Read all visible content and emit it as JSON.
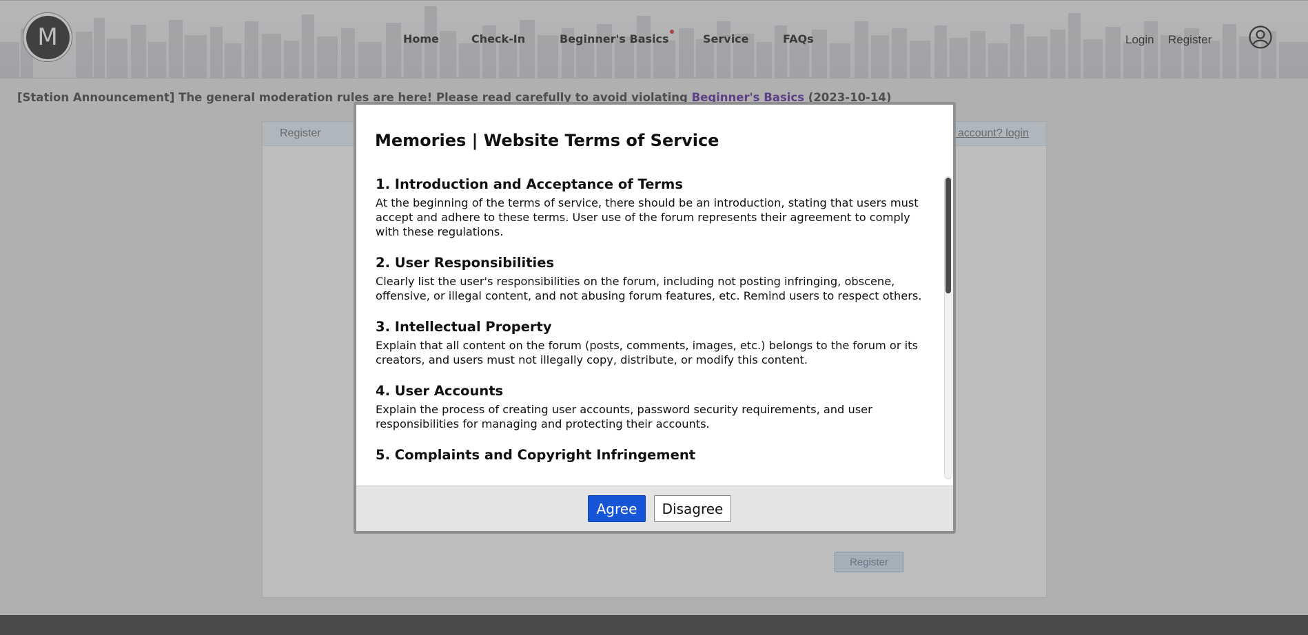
{
  "header": {
    "logo_letter": "M",
    "nav": [
      {
        "label": "Home"
      },
      {
        "label": "Check-In"
      },
      {
        "label": "Beginner's Basics"
      },
      {
        "label": "Service"
      },
      {
        "label": "FAQs"
      }
    ],
    "login_label": "Login",
    "register_label": "Register"
  },
  "announcement": {
    "text": "[Station Announcement] The general moderation rules are here! Please read carefully to avoid violating ",
    "link": "Beginner's Basics",
    "date": "(2023-10-14)"
  },
  "register_panel": {
    "tab_label": "Register",
    "login_link": "Already have an account? login",
    "submit_label": "Register"
  },
  "modal": {
    "title": "Memories | Website Terms of Service",
    "sections": [
      {
        "heading": "1. Introduction and Acceptance of Terms",
        "body": "At the beginning of the terms of service, there should be an introduction, stating that users must accept and adhere to these terms. User use of the forum represents their agreement to comply with these regulations."
      },
      {
        "heading": "2. User Responsibilities",
        "body": "Clearly list the user's responsibilities on the forum, including not posting infringing, obscene, offensive, or illegal content, and not abusing forum features, etc. Remind users to respect others."
      },
      {
        "heading": "3. Intellectual Property",
        "body": "Explain that all content on the forum (posts, comments, images, etc.) belongs to the forum or its creators, and users must not illegally copy, distribute, or modify this content."
      },
      {
        "heading": "4. User Accounts",
        "body": "Explain the process of creating user accounts, password security requirements, and user responsibilities for managing and protecting their accounts."
      },
      {
        "heading": "5. Complaints and Copyright Infringement",
        "body": ""
      }
    ],
    "agree_label": "Agree",
    "disagree_label": "Disagree"
  },
  "colors": {
    "agree_button": "#1656d6",
    "notification_dot": "#e02020",
    "announcement_link": "#4b1a9a"
  }
}
